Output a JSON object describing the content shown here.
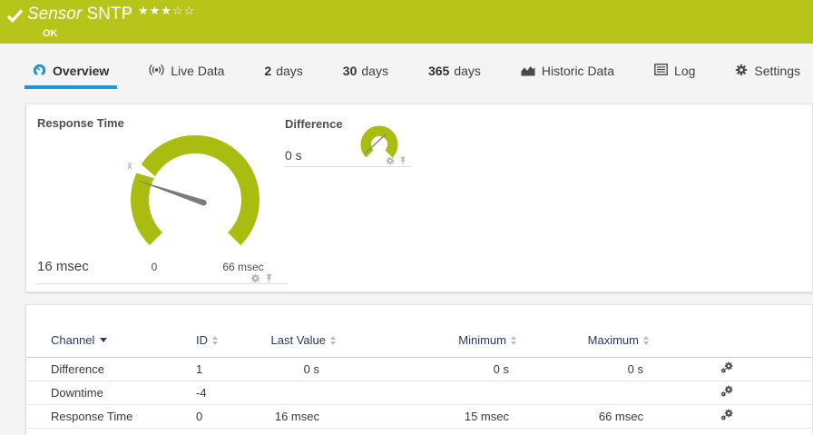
{
  "colors": {
    "brand_green": "#b7c41a",
    "gauge_green": "#a9bd11",
    "accent_blue": "#1b97d4",
    "table_header_navy": "#27395f"
  },
  "header": {
    "title_prefix": "Sensor",
    "title": "SNTP",
    "status": "OK",
    "stars_filled": "★★★",
    "stars_empty": "☆☆",
    "flag_glyph": "⚐",
    "priority_filled": 3,
    "priority_total": 5
  },
  "tabs": [
    {
      "label": "Overview",
      "active": true
    },
    {
      "label": "Live Data"
    },
    {
      "num": "2",
      "label": "days"
    },
    {
      "num": "30",
      "label": "days"
    },
    {
      "num": "365",
      "label": "days"
    },
    {
      "label": "Historic Data"
    },
    {
      "label": "Log"
    },
    {
      "label": "Settings"
    }
  ],
  "gauges": {
    "response_time": {
      "title": "Response Time",
      "value_label": "16 msec",
      "value": 16,
      "unit": "msec",
      "scale_min": 0,
      "scale_min_label": "0",
      "scale_max": 66,
      "scale_max_label": "66 msec",
      "avg_marker": "x̄"
    },
    "difference": {
      "title": "Difference",
      "value_label": "0 s",
      "value": 0,
      "unit": "s"
    }
  },
  "table": {
    "columns": [
      {
        "label": "Channel",
        "sorted": "desc"
      },
      {
        "label": "ID"
      },
      {
        "label": "Last Value"
      },
      {
        "label": "Minimum"
      },
      {
        "label": "Maximum"
      }
    ],
    "rows": [
      {
        "channel": "Difference",
        "id": "1",
        "last": "0 s",
        "min": "0 s",
        "max": "0 s"
      },
      {
        "channel": "Downtime",
        "id": "-4",
        "last": "",
        "min": "",
        "max": ""
      },
      {
        "channel": "Response Time",
        "id": "0",
        "last": "16 msec",
        "min": "15 msec",
        "max": "66 msec"
      }
    ]
  }
}
